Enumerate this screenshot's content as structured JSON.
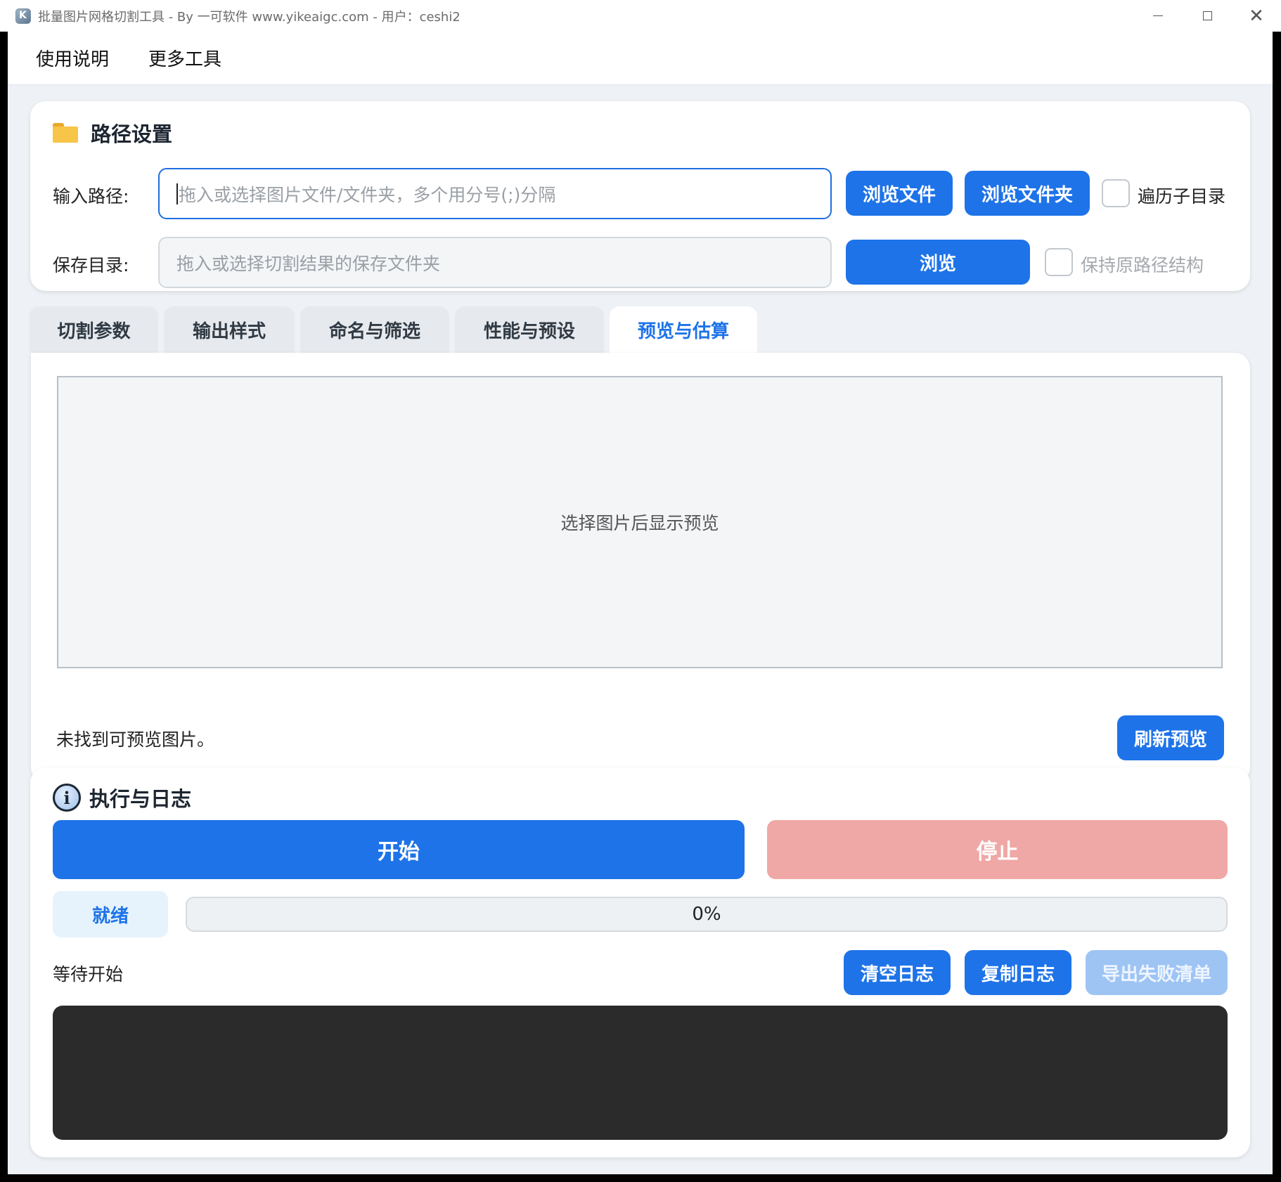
{
  "window": {
    "title": "批量图片网格切割工具 - By 一可软件 www.yikeaigc.com  -  用户：ceshi2"
  },
  "menu": {
    "items": [
      "使用说明",
      "更多工具"
    ]
  },
  "path_settings": {
    "title": "路径设置",
    "input_label": "输入路径:",
    "input_placeholder": "拖入或选择图片文件/文件夹，多个用分号(;)分隔",
    "input_value": "",
    "browse_file_label": "浏览文件",
    "browse_folder_label": "浏览文件夹",
    "recurse_label": "遍历子目录",
    "recurse_checked": false,
    "save_label": "保存目录:",
    "save_placeholder": "拖入或选择切割结果的保存文件夹",
    "save_value": "",
    "browse_label": "浏览",
    "keep_structure_label": "保持原路径结构",
    "keep_structure_checked": false
  },
  "tabs": [
    {
      "label": "切割参数",
      "active": false
    },
    {
      "label": "输出样式",
      "active": false
    },
    {
      "label": "命名与筛选",
      "active": false
    },
    {
      "label": "性能与预设",
      "active": false
    },
    {
      "label": "预览与估算",
      "active": true
    }
  ],
  "preview": {
    "placeholder": "选择图片后显示预览",
    "status_text": "未找到可预览图片。",
    "refresh_label": "刷新预览"
  },
  "execution": {
    "title": "执行与日志",
    "start_label": "开始",
    "stop_label": "停止",
    "status_badge": "就绪",
    "progress_percent": 0,
    "progress_text": "0%",
    "wait_text": "等待开始",
    "clear_log_label": "清空日志",
    "copy_log_label": "复制日志",
    "export_failed_label": "导出失败清单"
  },
  "colors": {
    "accent": "#1e73e8",
    "stop": "#efa8a5",
    "disabled": "#9ec4f4",
    "log_bg": "#2b2b2b"
  }
}
